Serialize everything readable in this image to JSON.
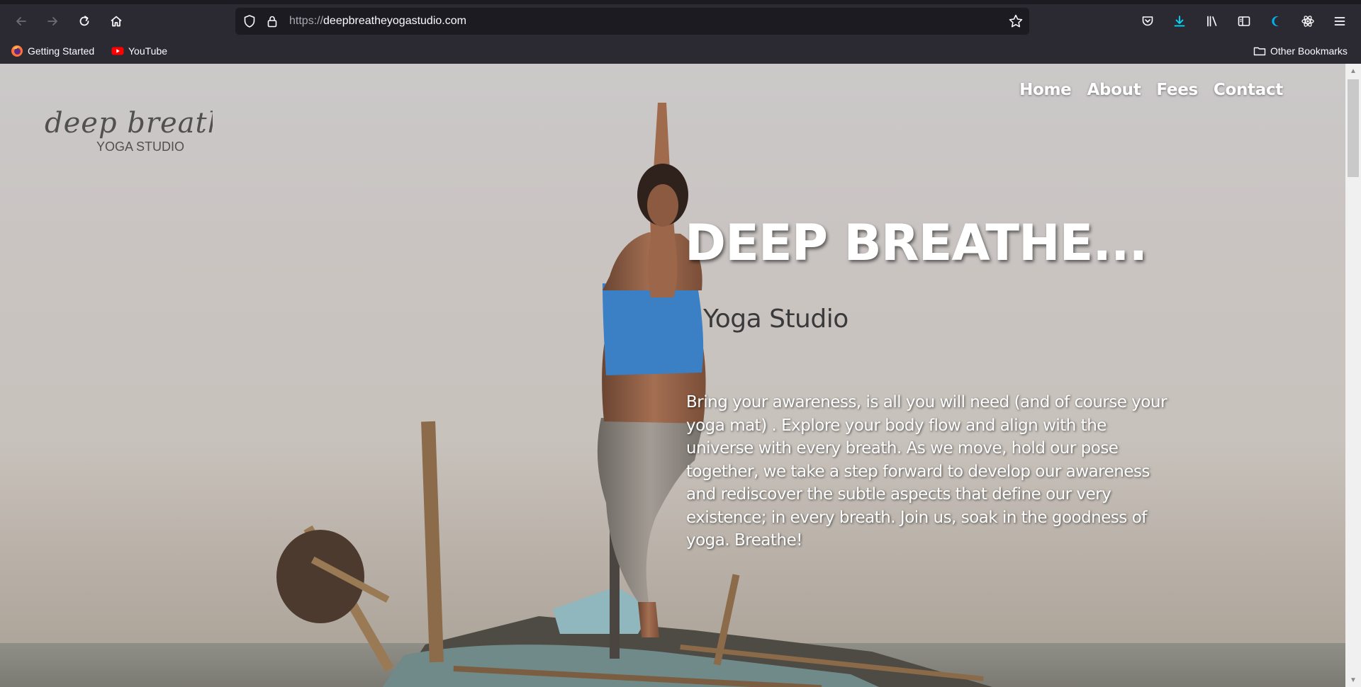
{
  "browser": {
    "url_scheme": "https://",
    "url_host": "deepbreatheyogastudio.com",
    "bookmarks": [
      {
        "label": "Getting Started",
        "icon": "firefox-icon"
      },
      {
        "label": "YouTube",
        "icon": "youtube-icon"
      }
    ],
    "other_bookmarks": "Other Bookmarks",
    "accent_color": "#00ddff"
  },
  "site": {
    "logo_script": "deep breathe",
    "logo_text": "YOGA STUDIO",
    "nav": [
      "Home",
      "About",
      "Fees",
      "Contact"
    ],
    "hero_title": "DEEP BREATHE...",
    "hero_subtitle": "Yoga Studio",
    "hero_body": "Bring your awareness, is all you will need (and of course your yoga mat) . Explore your body flow and align with the universe with every breath. As we move, hold our pose together, we take a step forward to develop our awareness and rediscover the subtle aspects that define our very existence; in every breath. Join us, soak in the goodness of yoga. Breathe!"
  }
}
